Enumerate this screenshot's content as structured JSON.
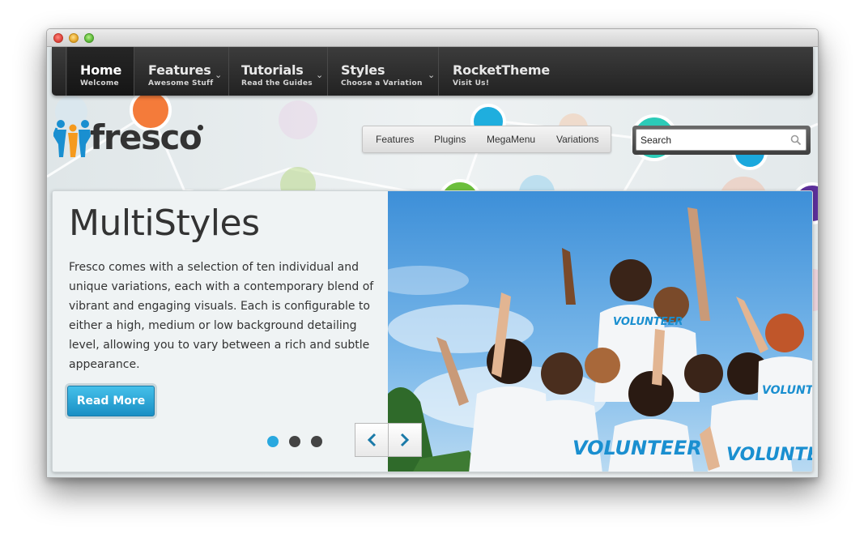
{
  "nav": {
    "items": [
      {
        "label": "Home",
        "sub": "Welcome",
        "active": true
      },
      {
        "label": "Features",
        "sub": "Awesome Stuff",
        "dropdown": true
      },
      {
        "label": "Tutorials",
        "sub": "Read the Guides",
        "dropdown": true
      },
      {
        "label": "Styles",
        "sub": "Choose a Variation",
        "dropdown": true
      },
      {
        "label": "RocketTheme",
        "sub": "Visit Us!"
      }
    ]
  },
  "logo": {
    "text": "fresco",
    "mark": "registered"
  },
  "submenu": {
    "items": [
      "Features",
      "Plugins",
      "MegaMenu",
      "Variations"
    ]
  },
  "search": {
    "placeholder": "Search",
    "icon": "search-icon"
  },
  "slide": {
    "title": "MultiStyles",
    "description": "Fresco comes with a selection of ten individual and unique variations, each with a contemporary blend of vibrant and engaging visuals. Each is configurable to either a high, medium or low background detailing level, allowing you to vary between a rich and subtle appearance.",
    "button": "Read More",
    "pagination": {
      "count": 3,
      "active": 1
    },
    "shirt_text": "VOLUNTEER"
  },
  "colors": {
    "accent": "#29a8df",
    "nav_bg": "#2b2b2b",
    "logo_blue": "#1a8fd0",
    "logo_orange": "#f59a1e"
  }
}
